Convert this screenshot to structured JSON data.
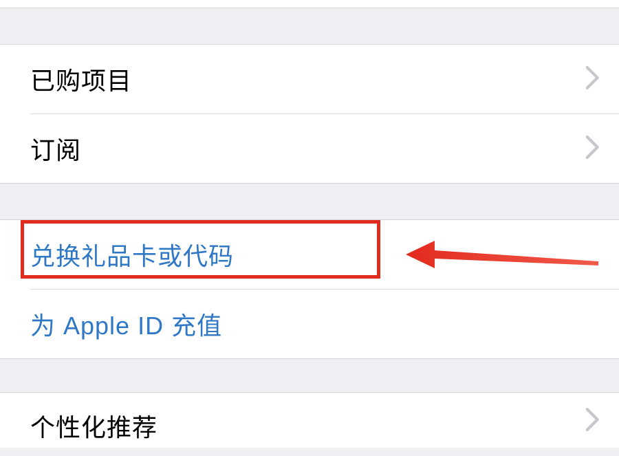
{
  "sections": {
    "first": {
      "purchased": "已购项目",
      "subscriptions": "订阅"
    },
    "second": {
      "redeem": "兑换礼品卡或代码",
      "addFunds": "为 Apple ID 充值"
    },
    "third": {
      "personalized": "个性化推荐"
    }
  },
  "colors": {
    "link": "#2f78c5",
    "highlight": "#e22b1e",
    "background": "#efeff4"
  }
}
